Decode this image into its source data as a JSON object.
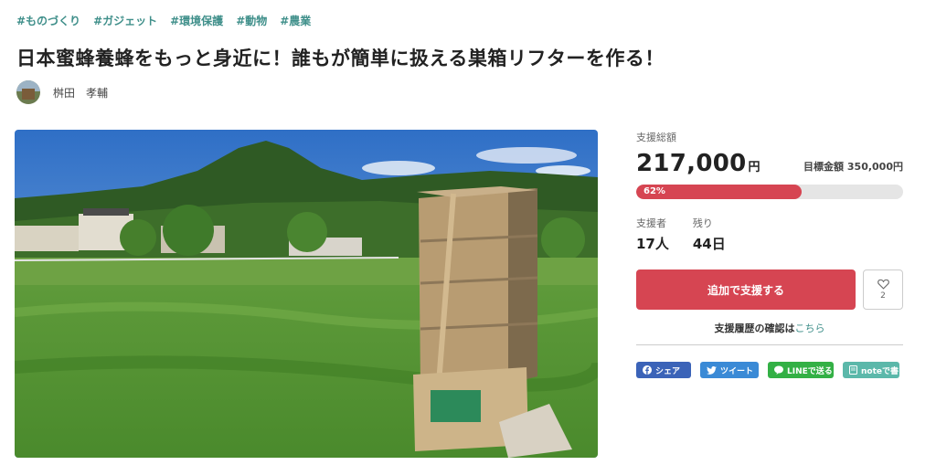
{
  "tags": [
    "#ものづくり",
    "#ガジェット",
    "#環境保護",
    "#動物",
    "#農業"
  ],
  "title": "日本蜜蜂養蜂をもっと身近に！誰もが簡単に扱える巣箱リフターを作る！",
  "author": {
    "name": "桝田　孝輔"
  },
  "funding": {
    "total_label": "支援総額",
    "total_amount": "217,000",
    "currency": "円",
    "goal_label": "目標金額",
    "goal_amount": "350,000円",
    "progress_text": "62%",
    "progress": 0.62,
    "supporters_label": "支援者",
    "supporters": "17人",
    "remaining_label": "残り",
    "remaining": "44日"
  },
  "actions": {
    "support_label": "追加で支援する",
    "favorite_count": "2",
    "history_text": "支援履歴の確認は",
    "history_link": "こちら"
  },
  "share": {
    "facebook": "シェア",
    "twitter": "ツイート",
    "line": "LINEで送る",
    "note": "noteで書く"
  },
  "colors": {
    "accent": "#d64552",
    "tag": "#3f8f8a",
    "facebook": "#3b63b8",
    "twitter": "#3a8ad6",
    "line": "#33b045",
    "note": "#5bb8aa"
  }
}
